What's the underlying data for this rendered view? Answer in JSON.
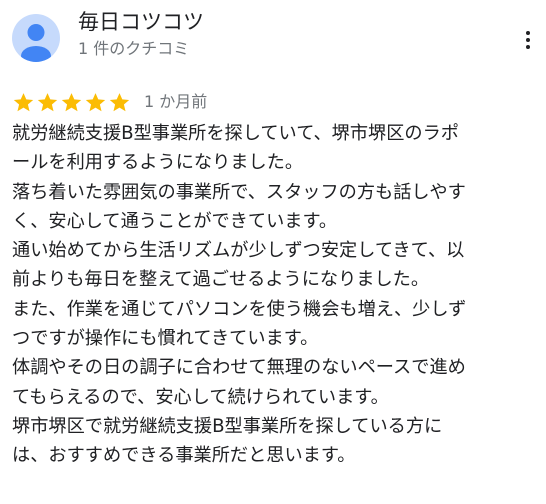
{
  "reviewer": {
    "name": "毎日コツコツ",
    "review_count": "1 件のクチコミ",
    "avatar_color": "#c6dafc",
    "avatar_figure_color": "#4285f4"
  },
  "menu": {
    "icon": "more-vert-icon"
  },
  "rating": {
    "stars": 5,
    "max_stars": 5,
    "star_color": "#fbbc04",
    "date": "1 か月前"
  },
  "review": {
    "lines": [
      "就労継続支援B型事業所を探していて、堺市堺区のラポ",
      "ールを利用するようになりました。",
      "落ち着いた雰囲気の事業所で、スタッフの方も話しやす",
      "く、安心して通うことができています。",
      "通い始めてから生活リズムが少しずつ安定してきて、以",
      "前よりも毎日を整えて過ごせるようになりました。",
      "また、作業を通じてパソコンを使う機会も増え、少しず",
      "つですが操作にも慣れてきています。",
      "体調やその日の調子に合わせて無理のないペースで進め",
      "てもらえるので、安心して続けられています。",
      "堺市堺区で就労継続支援B型事業所を探している方に",
      "は、おすすめできる事業所だと思います。"
    ]
  }
}
